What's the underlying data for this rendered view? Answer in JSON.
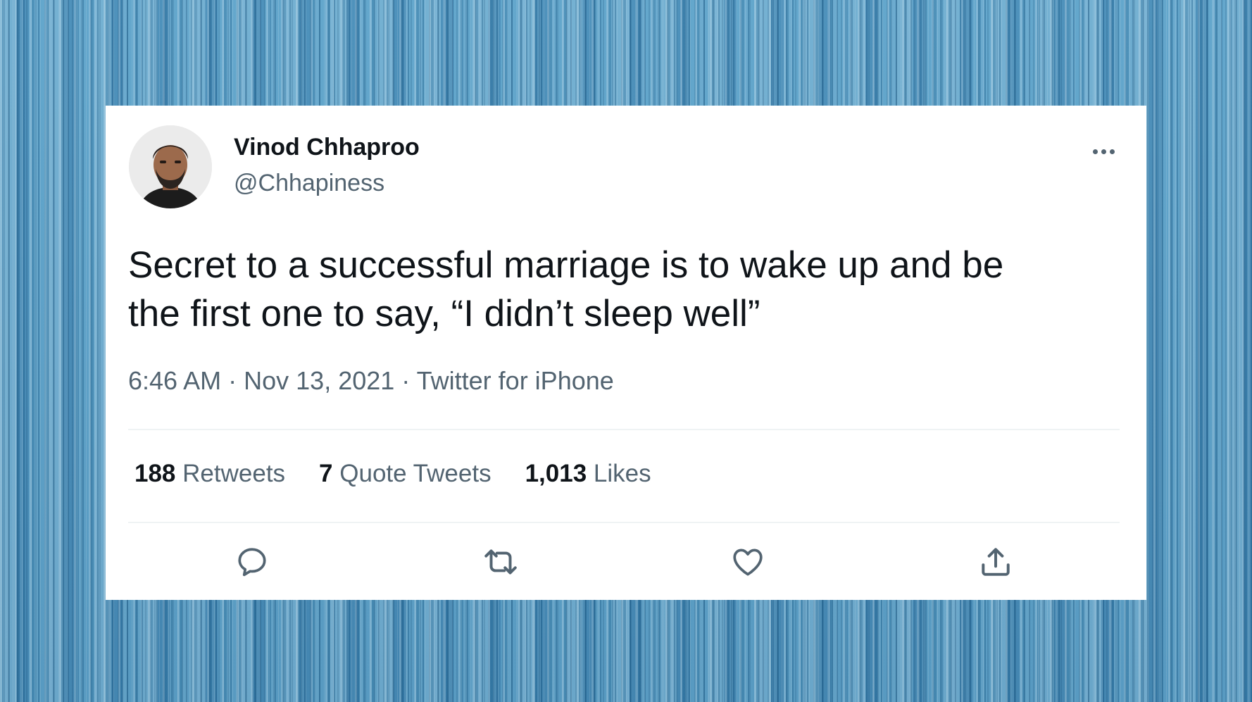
{
  "tweet": {
    "author_name": "Vinod Chhaproo",
    "author_handle": "@Chhapiness",
    "text_line1": "Secret to a successful marriage is to wake up and be",
    "text_line2": "the first one to say, “I didn’t sleep well”",
    "time": "6:46 AM",
    "date": "Nov 13, 2021",
    "source": "Twitter for iPhone",
    "separator": "·"
  },
  "stats": {
    "retweets_count": "188",
    "retweets_label": "Retweets",
    "quotes_count": "7",
    "quotes_label": "Quote Tweets",
    "likes_count": "1,013",
    "likes_label": "Likes"
  },
  "actions": [
    "reply-icon",
    "retweet-icon",
    "like-icon",
    "share-icon"
  ],
  "colors": {
    "text_primary": "#0f1419",
    "text_secondary": "#536471",
    "divider": "#eff3f4",
    "background": "#4a94bf"
  }
}
